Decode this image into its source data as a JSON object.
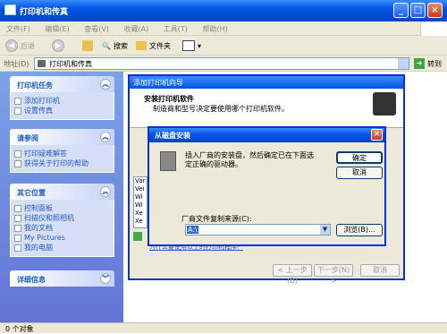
{
  "window": {
    "title": "打印机和传真"
  },
  "menu": [
    "文件(F)",
    "编辑(E)",
    "查看(V)",
    "收藏(A)",
    "工具(T)",
    "帮助(H)"
  ],
  "toolbar": {
    "back": "后退",
    "search": "搜索",
    "folders": "文件夹"
  },
  "address": {
    "label": "地址(D)",
    "value": "打印机和传真",
    "go": "转到"
  },
  "left_panels": [
    {
      "title": "打印机任务",
      "items": [
        "添加打印机",
        "设置传真"
      ]
    },
    {
      "title": "请参阅",
      "items": [
        "打印疑难解答",
        "获得关于打印的帮助"
      ]
    },
    {
      "title": "其它位置",
      "items": [
        "控制面板",
        "扫描仪和照相机",
        "我的文档",
        "My Pictures",
        "我的电脑"
      ]
    },
    {
      "title": "详细信息",
      "items": []
    }
  ],
  "status": "0 个对象",
  "wizard": {
    "title": "添加打印机向导",
    "heading": "安装打印机软件",
    "subheading": "制造商和型号决定要使用哪个打印机软件。",
    "list_partial": [
      "Var",
      "Vei",
      "Wi",
      "Wi",
      "Xe",
      "Xe"
    ],
    "link_partial": "为什么要使用以上的打印机程序？",
    "back_button": "< 上一步(B)",
    "next_button": "下一步(N) >",
    "cancel_button": "取消"
  },
  "dialog": {
    "title": "从磁盘安装",
    "message": "插入厂商的安装盘，然后确定已在下面选定正确的驱动器。",
    "ok_button": "确定",
    "cancel_button": "取消",
    "source_label": "厂商文件复制来源(C):",
    "source_value": "A:\\",
    "browse_button": "浏览(B)..."
  }
}
